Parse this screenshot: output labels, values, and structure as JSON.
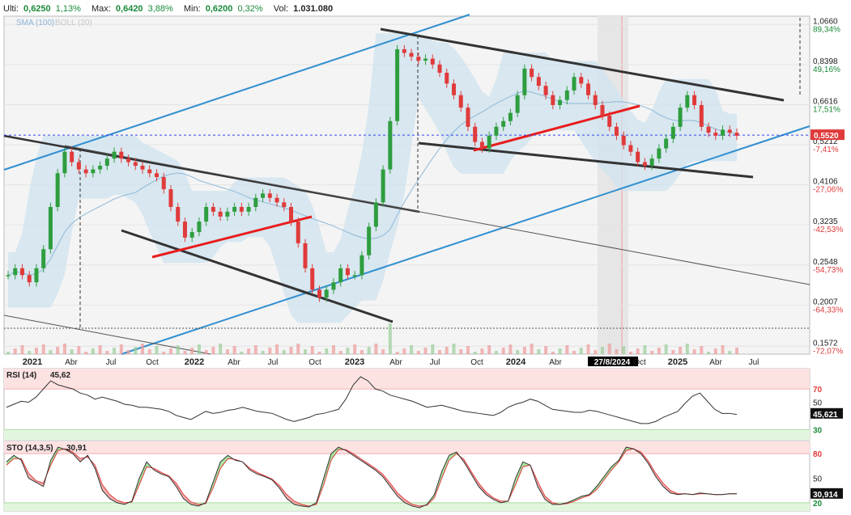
{
  "header": {
    "last_label": "Ulti:",
    "last_value": "0,6250",
    "last_change": "1,13%",
    "max_label": "Max:",
    "max_value": "0,6420",
    "max_change": "3,88%",
    "min_label": "Min:",
    "min_value": "0,6200",
    "min_change": "0,32%",
    "vol_label": "Vol:",
    "vol_value": "1.031.080"
  },
  "colors": {
    "price_up": "#2e9e3e",
    "price_down": "#e03a3a",
    "channel_blue": "#2f8fd0",
    "trend_black": "#333333",
    "trend_red": "#e81c1c",
    "bollinger_fill": "#cfe3ef",
    "rsi_line": "#333333",
    "sto_k": "#333333",
    "sto_d": "#e03a3a",
    "overbought_zone": "#fde2e2",
    "oversold_zone": "#e2f6dd",
    "current_price_line": "#3344ee"
  },
  "chart_data": [
    {
      "type": "candlestick",
      "legend": [
        "SMA (100)",
        "BOLL (20)"
      ],
      "legend_placement": "top-left",
      "x_ticks": [
        "2021",
        "Abr",
        "Jul",
        "Oct",
        "2022",
        "Abr",
        "Jul",
        "Oct",
        "2023",
        "Abr",
        "Jul",
        "Oct",
        "2024",
        "Abr",
        "27/8/2024",
        "Oct",
        "2025",
        "Abr",
        "Jul"
      ],
      "y_scale": "log",
      "y_ticks": [
        {
          "value": "1,0660",
          "change": "89,34%"
        },
        {
          "value": "0,8398",
          "change": "49,16%"
        },
        {
          "value": "0,6616",
          "change": "17,51%"
        },
        {
          "value": "0,5212",
          "change": "-7,41%"
        },
        {
          "value": "0,4106",
          "change": "-27,06%"
        },
        {
          "value": "0,3235",
          "change": "-42,53%"
        },
        {
          "value": "0,2548",
          "change": "-54,73%"
        },
        {
          "value": "0,2007",
          "change": "-64,33%"
        },
        {
          "value": "0,1572",
          "change": "-72,07%"
        }
      ],
      "current_price": "0,5520",
      "ylim": [
        0.15,
        1.12
      ],
      "approx_close_series": [
        0.24,
        0.25,
        0.24,
        0.23,
        0.25,
        0.28,
        0.36,
        0.44,
        0.5,
        0.47,
        0.45,
        0.44,
        0.45,
        0.46,
        0.48,
        0.5,
        0.48,
        0.47,
        0.46,
        0.45,
        0.44,
        0.43,
        0.4,
        0.36,
        0.33,
        0.3,
        0.31,
        0.33,
        0.36,
        0.35,
        0.34,
        0.35,
        0.36,
        0.35,
        0.36,
        0.38,
        0.39,
        0.38,
        0.37,
        0.36,
        0.33,
        0.29,
        0.25,
        0.22,
        0.21,
        0.22,
        0.23,
        0.25,
        0.24,
        0.24,
        0.27,
        0.32,
        0.37,
        0.45,
        0.6,
        0.92,
        0.9,
        0.88,
        0.86,
        0.87,
        0.84,
        0.8,
        0.75,
        0.7,
        0.65,
        0.58,
        0.53,
        0.51,
        0.55,
        0.58,
        0.6,
        0.63,
        0.7,
        0.82,
        0.78,
        0.74,
        0.7,
        0.66,
        0.68,
        0.72,
        0.78,
        0.75,
        0.7,
        0.66,
        0.62,
        0.58,
        0.55,
        0.52,
        0.5,
        0.47,
        0.46,
        0.48,
        0.51,
        0.54,
        0.58,
        0.65,
        0.7,
        0.66,
        0.58,
        0.56,
        0.55,
        0.57,
        0.56,
        0.55
      ]
    },
    {
      "type": "line",
      "label": "RSI (14)",
      "label_value": "45,62",
      "current_value": "45,621",
      "y_ticks": [
        "70",
        "30"
      ],
      "partial_tick": "50",
      "zones": {
        "overbought": 70,
        "oversold": 30
      },
      "ylim": [
        20,
        90
      ],
      "values": [
        52,
        55,
        58,
        57,
        62,
        70,
        78,
        74,
        72,
        70,
        66,
        64,
        60,
        62,
        60,
        58,
        55,
        54,
        52,
        52,
        51,
        50,
        48,
        44,
        42,
        40,
        44,
        48,
        46,
        47,
        49,
        50,
        52,
        50,
        48,
        47,
        46,
        43,
        40,
        38,
        40,
        42,
        45,
        46,
        48,
        50,
        60,
        74,
        82,
        78,
        70,
        68,
        64,
        62,
        60,
        58,
        55,
        52,
        53,
        54,
        52,
        50,
        48,
        47,
        46,
        45,
        44,
        47,
        52,
        55,
        57,
        60,
        58,
        54,
        50,
        49,
        48,
        47,
        47,
        49,
        48,
        46,
        44,
        42,
        40,
        38,
        36,
        36,
        38,
        42,
        45,
        48,
        56,
        63,
        66,
        58,
        50,
        46,
        46,
        45
      ]
    },
    {
      "type": "line",
      "label": "STO (14,3,5)",
      "label_value": "30,91",
      "current_value": "30,914",
      "y_ticks": [
        "80",
        "50",
        "20"
      ],
      "zones": {
        "overbought": 80,
        "oversold": 20
      },
      "ylim": [
        10,
        95
      ],
      "series": [
        {
          "values": [
            70,
            78,
            72,
            50,
            45,
            40,
            72,
            88,
            85,
            80,
            70,
            78,
            62,
            35,
            25,
            20,
            18,
            22,
            50,
            70,
            60,
            55,
            52,
            40,
            25,
            18,
            16,
            20,
            45,
            70,
            78,
            72,
            70,
            60,
            55,
            52,
            48,
            38,
            25,
            18,
            16,
            15,
            20,
            50,
            80,
            88,
            84,
            78,
            72,
            66,
            60,
            52,
            40,
            28,
            20,
            16,
            14,
            18,
            30,
            58,
            78,
            82,
            70,
            55,
            40,
            30,
            24,
            20,
            22,
            50,
            70,
            66,
            40,
            24,
            18,
            18,
            20,
            24,
            28,
            30,
            40,
            52,
            64,
            72,
            88,
            86,
            80,
            68,
            52,
            40,
            32,
            30,
            31,
            30,
            32,
            31,
            30,
            30,
            31,
            31
          ]
        },
        {
          "values": [
            66,
            74,
            74,
            56,
            47,
            44,
            66,
            84,
            86,
            82,
            74,
            76,
            66,
            42,
            30,
            23,
            20,
            21,
            42,
            64,
            62,
            57,
            53,
            44,
            30,
            21,
            18,
            19,
            38,
            62,
            74,
            73,
            70,
            62,
            57,
            53,
            49,
            41,
            30,
            22,
            18,
            16,
            18,
            42,
            72,
            85,
            85,
            80,
            74,
            68,
            62,
            55,
            44,
            32,
            24,
            18,
            16,
            17,
            26,
            50,
            72,
            80,
            73,
            58,
            44,
            33,
            26,
            22,
            22,
            42,
            64,
            66,
            46,
            28,
            20,
            18,
            19,
            22,
            26,
            29,
            36,
            48,
            60,
            70,
            84,
            86,
            82,
            71,
            56,
            44,
            35,
            31,
            31,
            30,
            31,
            31,
            30,
            30,
            31,
            31
          ]
        }
      ]
    }
  ]
}
